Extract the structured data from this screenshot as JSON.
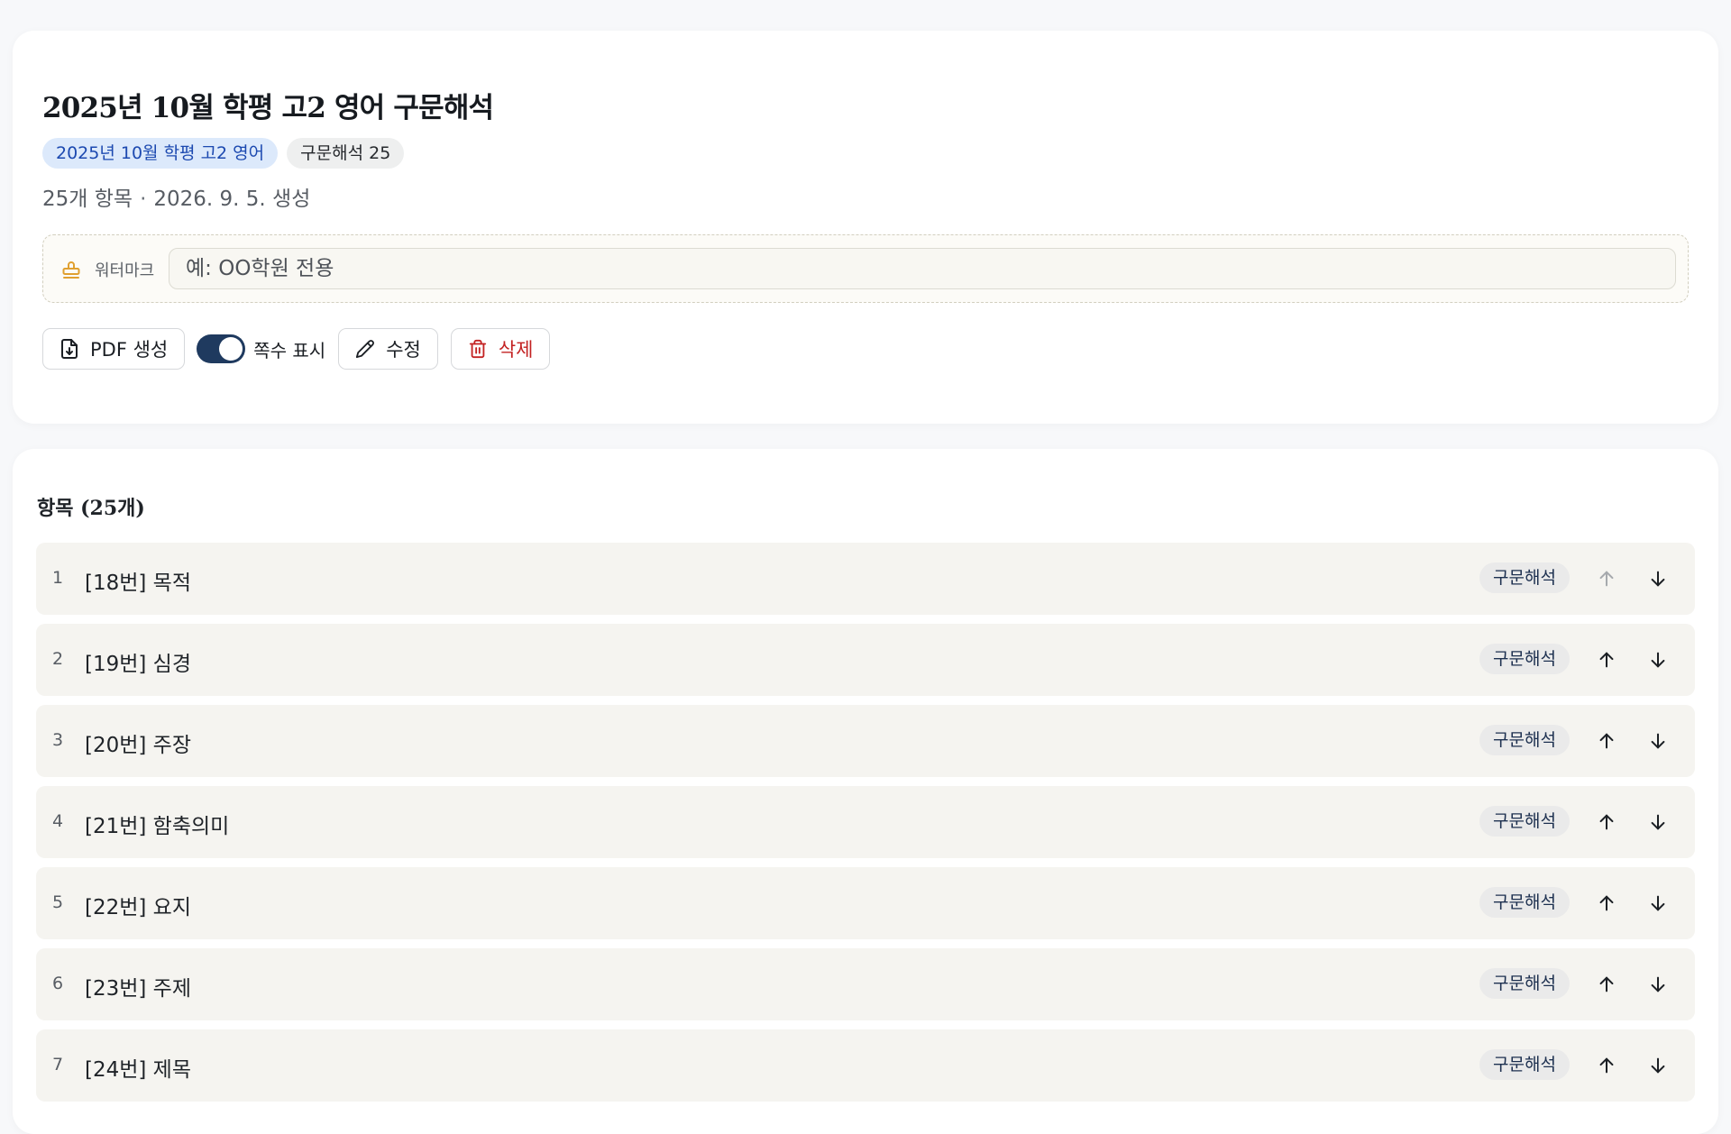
{
  "page": {
    "title": "2025년 10월 학평 고2 영어 구문해석",
    "badges": [
      {
        "label": "2025년 10월 학평 고2 영어"
      },
      {
        "label": "구문해석 25"
      }
    ],
    "meta": {
      "count": "25개 항목",
      "separator": "·",
      "created": "2026. 9. 5. 생성"
    }
  },
  "watermark": {
    "icon": "stamp-icon",
    "label": "워터마크",
    "value": "",
    "placeholder": "예: OO학원 전용"
  },
  "toolbar": {
    "pdf_label": "PDF 생성",
    "page_toggle_label": "쪽수 표시",
    "page_toggle_on": true,
    "edit_label": "수정",
    "delete_label": "삭제"
  },
  "items_section": {
    "title": "항목 (25개)",
    "items": [
      {
        "num": "1",
        "label": "[18번] 목적",
        "tag": "구문해석"
      },
      {
        "num": "2",
        "label": "[19번] 심경",
        "tag": "구문해석"
      },
      {
        "num": "3",
        "label": "[20번] 주장",
        "tag": "구문해석"
      },
      {
        "num": "4",
        "label": "[21번] 함축의미",
        "tag": "구문해석"
      },
      {
        "num": "5",
        "label": "[22번] 요지",
        "tag": "구문해석"
      },
      {
        "num": "6",
        "label": "[23번] 주제",
        "tag": "구문해석"
      },
      {
        "num": "7",
        "label": "[24번] 제목",
        "tag": "구문해석"
      }
    ]
  },
  "colors": {
    "accent_navy": "#1f3a5f",
    "danger": "#c32222",
    "badge_blue_bg": "#dce9fb",
    "badge_blue_text": "#1c49b0",
    "watermark_icon": "#e0a030"
  }
}
